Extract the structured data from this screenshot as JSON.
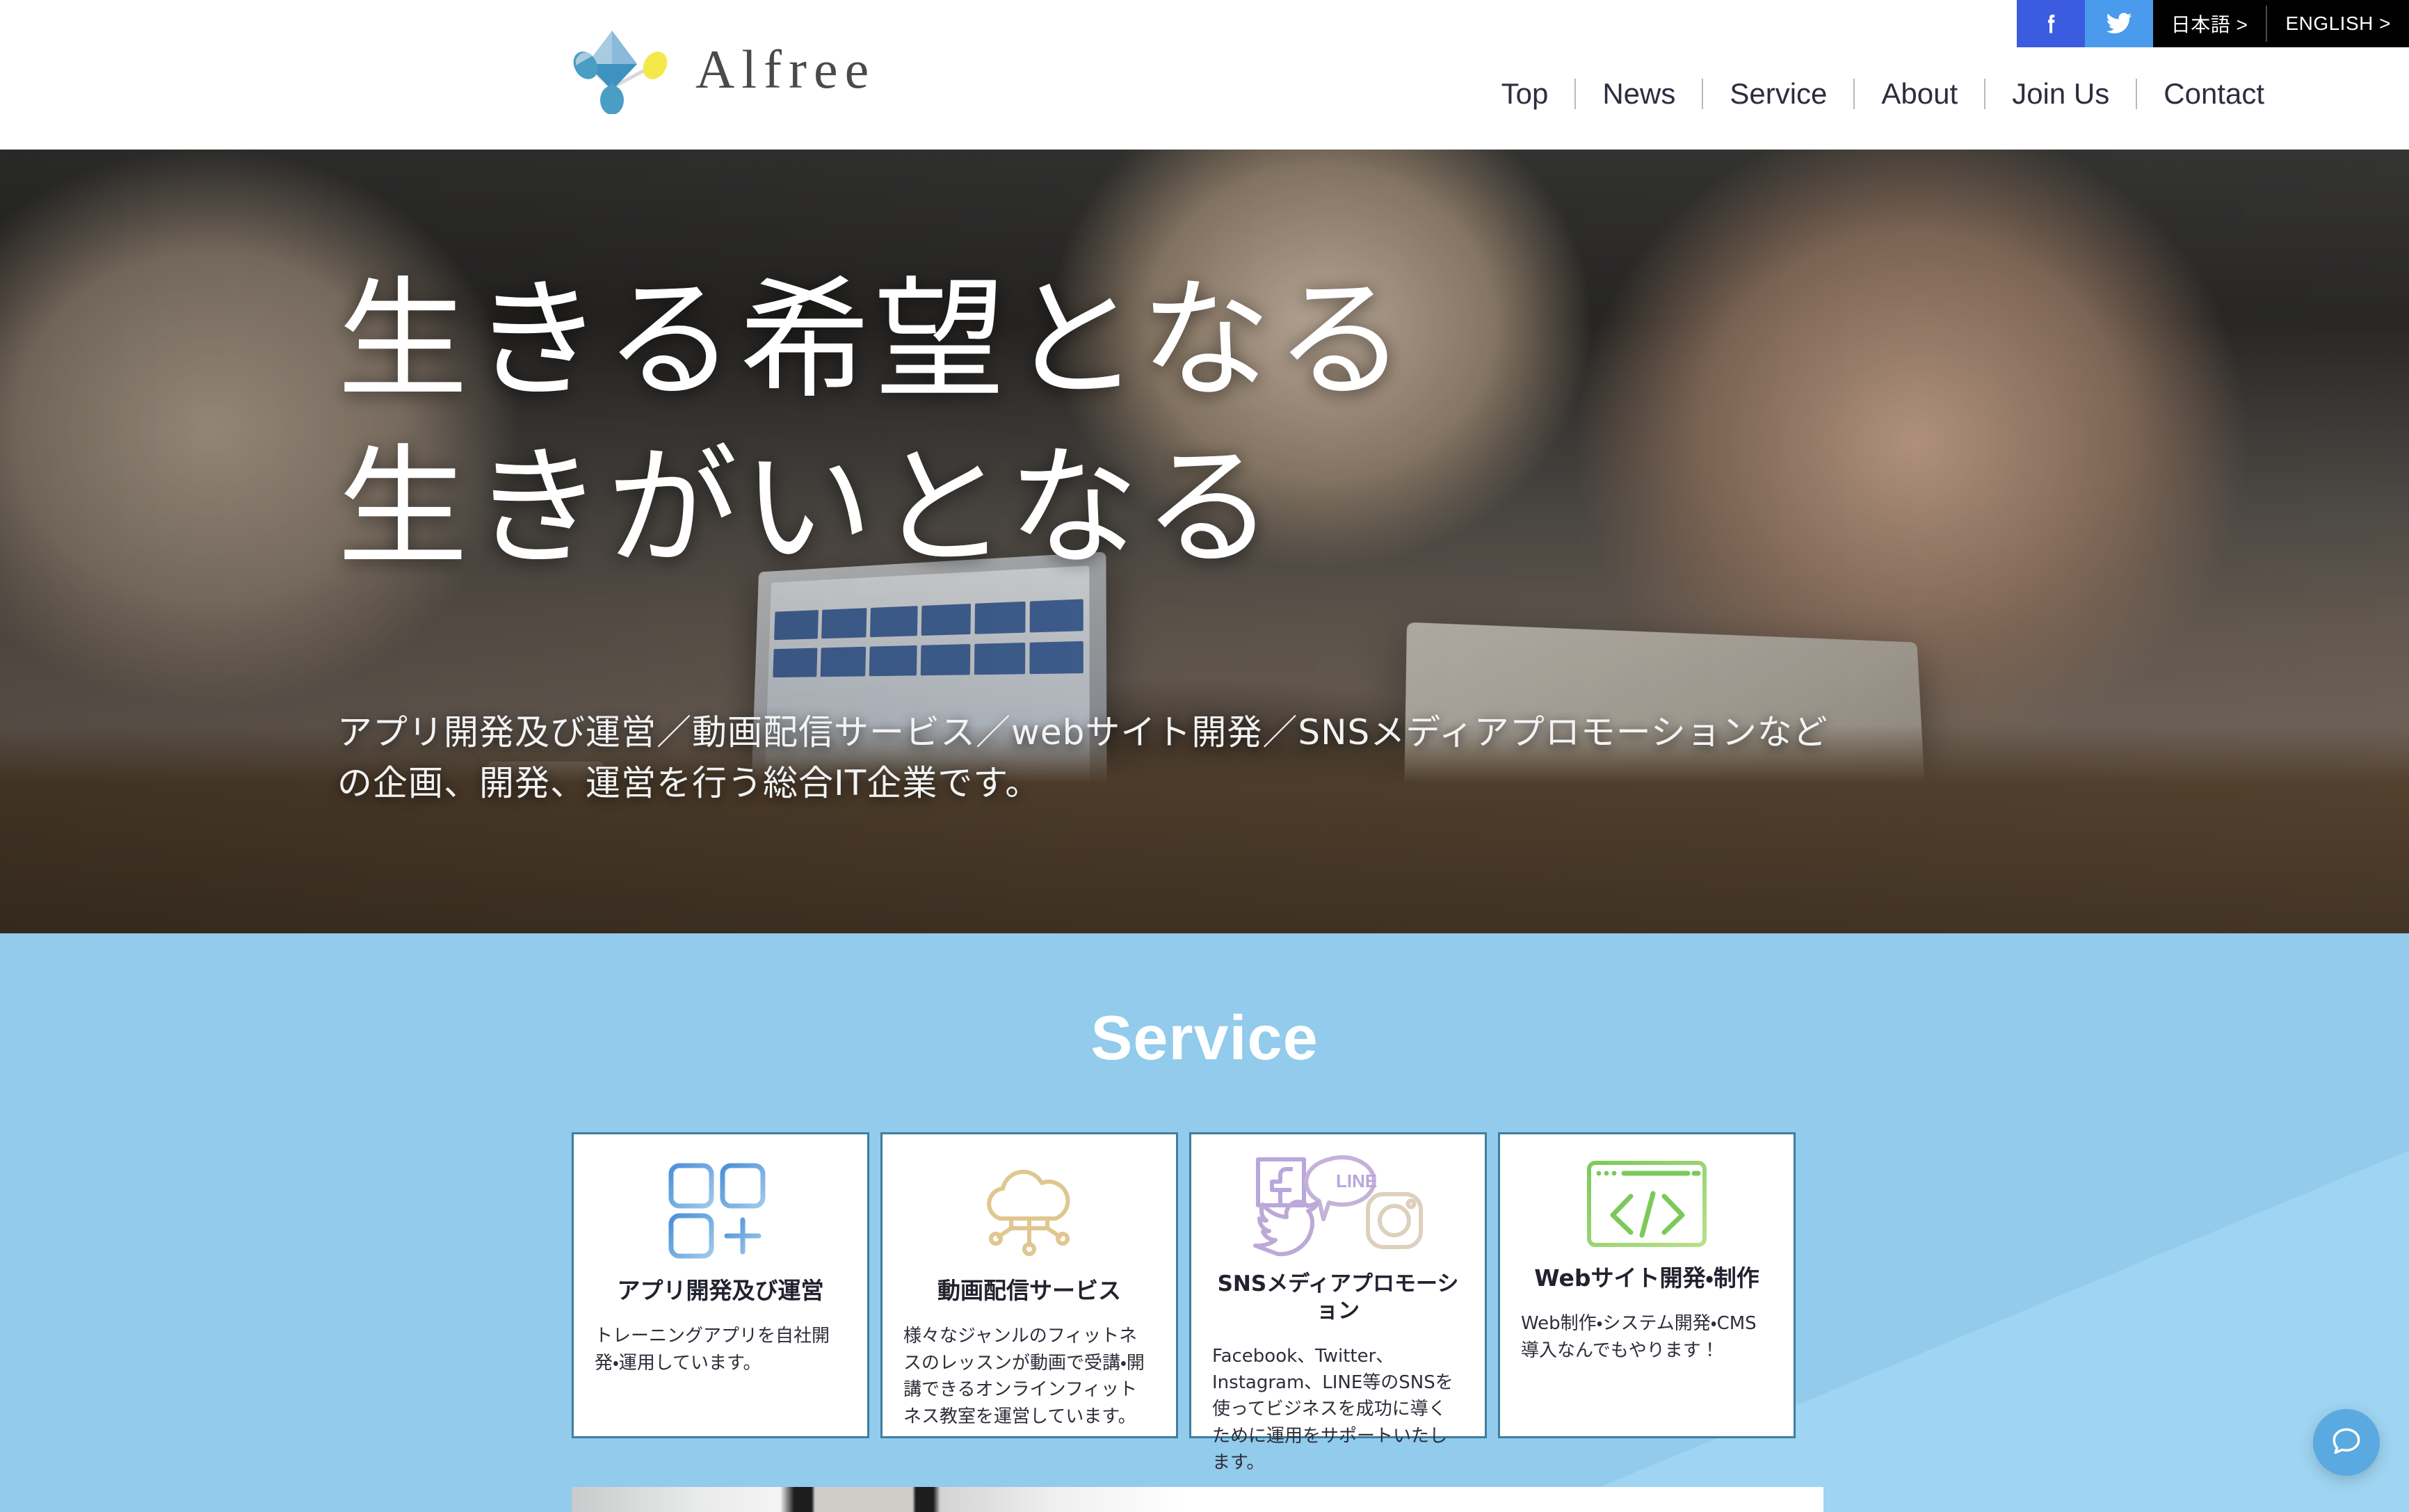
{
  "site": {
    "brand": "Alfree",
    "logo_icon": "alfree-diamond-logo"
  },
  "topbar": {
    "facebook_icon": "facebook-icon",
    "twitter_icon": "twitter-icon",
    "lang_ja": "日本語 >",
    "lang_en": "ENGLISH >"
  },
  "nav": {
    "items": [
      {
        "label": "Top"
      },
      {
        "label": "News"
      },
      {
        "label": "Service"
      },
      {
        "label": "About"
      },
      {
        "label": "Join Us"
      },
      {
        "label": "Contact"
      }
    ]
  },
  "hero": {
    "title_line1": "生きる希望となる",
    "title_line2": "生きがいとなる",
    "sub_line1": "アプリ開発及び運営／動画配信サービス／webサイト開発／SNSメディアプロモーションなど",
    "sub_line2": "の企画、開発、運営を行う総合IT企業です。"
  },
  "service": {
    "heading": "Service",
    "cards": [
      {
        "icon": "app-grid-plus-icon",
        "title": "アプリ開発及び運営",
        "desc": "トレーニングアプリを自社開発・運用しています。"
      },
      {
        "icon": "cloud-network-icon",
        "title": "動画配信サービス",
        "desc": "様々なジャンルのフィットネスのレッスンが動画で受講・開講できるオンラインフィットネス教室を運営しています。"
      },
      {
        "icon": "sns-logos-icon",
        "title": "SNSメディアプロモーション",
        "desc": "Facebook、Twitter、Instagram、LINE等のSNSを使ってビジネスを成功に導くために運用をサポートいたします。"
      },
      {
        "icon": "browser-code-icon",
        "title": "Webサイト開発・制作",
        "desc": "Web制作・システム開発・CMS導入なんでもやります！"
      }
    ]
  },
  "widgets": {
    "chat_icon": "chat-bubble-icon"
  },
  "colors": {
    "service_bg": "#92cbeb",
    "service_bg_accent": "#9fd5f2",
    "card_border": "#3f7e9e",
    "facebook": "#3b5ce0",
    "twitter": "#4a9bee",
    "lang_bg": "#000000",
    "nav_text": "#2d2d40",
    "logo_text": "#4a4a4a",
    "chat_fab": "#5aa9e0"
  }
}
